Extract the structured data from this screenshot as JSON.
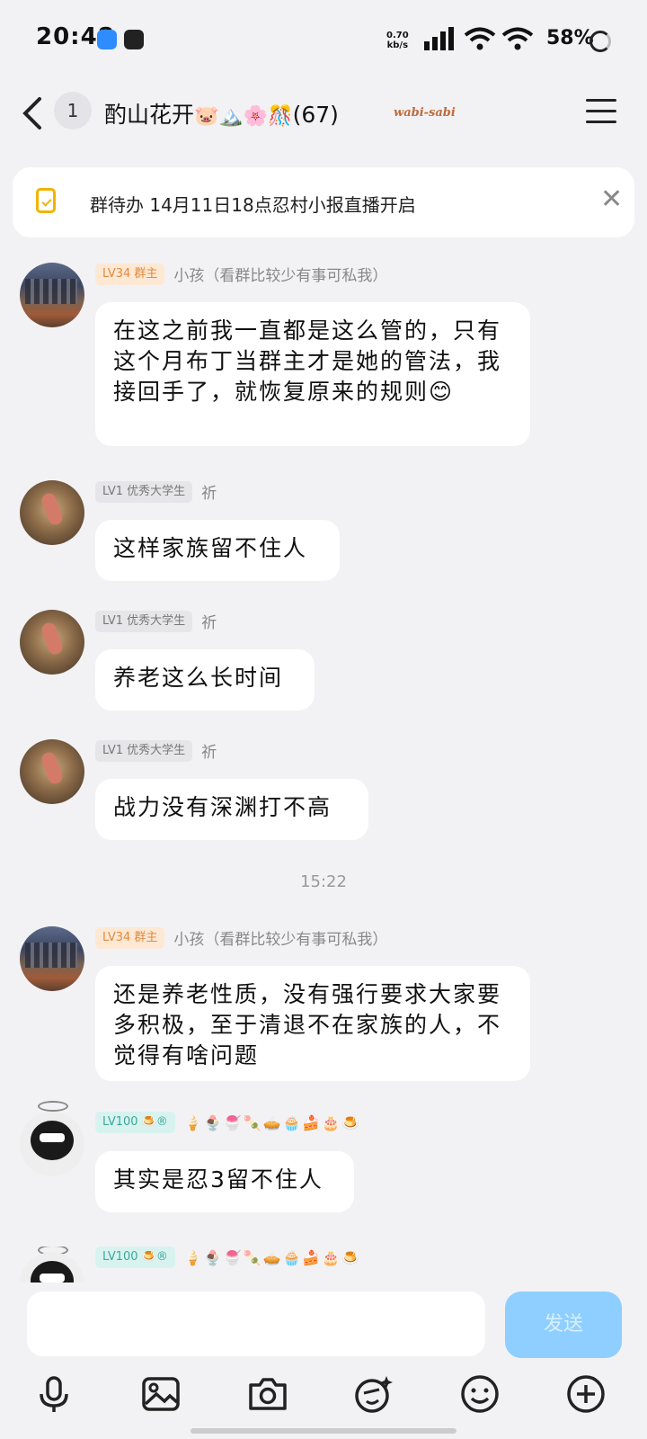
{
  "status_bar": {
    "time": "20:48",
    "net_speed_value": "0.70",
    "net_speed_unit": "kb/s",
    "battery": "58%",
    "icons": [
      "app-icon",
      "du-icon",
      "signal-icon",
      "wifi-icon",
      "wifi-icon",
      "battery-ring-icon"
    ]
  },
  "header": {
    "unread_count": "1",
    "title": "酌山花开",
    "title_emojis": "🐷🏔️🌸🎊",
    "member_count": "(67)",
    "tag": "wabi-sabi"
  },
  "todo_banner": {
    "text": "群待办 14月11日18点忍村小报直播开启"
  },
  "messages": [
    {
      "badge": "LV34 群主",
      "nickname": "小孩（看群比较少有事可私我）",
      "text": "在这之前我一直都是这么管的，只有这个月布丁当群主才是她的管法，我接回手了，就恢复原来的规则😊"
    },
    {
      "badge": "LV1 优秀大学生",
      "nickname": "祈",
      "text": "这样家族留不住人"
    },
    {
      "badge": "LV1 优秀大学生",
      "nickname": "祈",
      "text": "养老这么长时间"
    },
    {
      "badge": "LV1 优秀大学生",
      "nickname": "祈",
      "text": "战力没有深渊打不高"
    },
    {
      "badge": "LV34 群主",
      "nickname": "小孩（看群比较少有事可私我）",
      "text": "还是养老性质，没有强行要求大家要多积极，至于清退不在家族的人，不觉得有啥问题"
    },
    {
      "badge": "LV100 🍮®",
      "decorations": "🍦🍨🍧🍡🥧🧁🍰🎂🍮",
      "text": "其实是忍3留不住人"
    },
    {
      "badge": "LV100 🍮®",
      "decorations": "🍦🍨🍧🍡🥧🧁🍰🎂🍮",
      "text": ""
    }
  ],
  "timestamp": "15:22",
  "input": {
    "placeholder": "",
    "send_label": "发送"
  },
  "toolbar": [
    "microphone-icon",
    "image-icon",
    "camera-icon",
    "sticker-icon",
    "emoji-icon",
    "plus-icon"
  ]
}
